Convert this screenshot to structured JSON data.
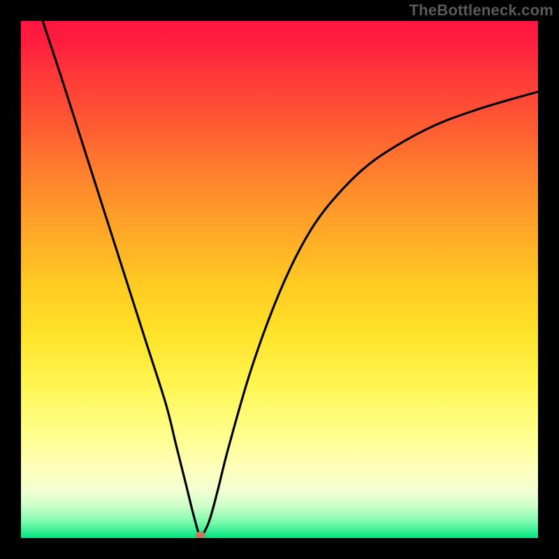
{
  "watermark": "TheBottleneck.com",
  "marker": {
    "x_frac": 0.347,
    "y_frac": 0.994,
    "color": "#c77964"
  },
  "chart_data": {
    "type": "line",
    "title": "",
    "xlabel": "",
    "ylabel": "",
    "xlim": [
      0,
      100
    ],
    "ylim": [
      0,
      100
    ],
    "grid": false,
    "series": [
      {
        "name": "bottleneck-curve",
        "x": [
          4.2,
          8,
          12,
          16,
          20,
          24,
          28,
          30,
          32,
          33.5,
          34.7,
          36.3,
          38,
          40,
          44,
          48,
          52,
          56,
          60,
          66,
          72,
          80,
          88,
          96,
          100
        ],
        "y": [
          100,
          88.5,
          76,
          63.5,
          51,
          38.5,
          26,
          18,
          10,
          4,
          0.6,
          3,
          9,
          17,
          31,
          42.5,
          52,
          59.5,
          65,
          71.2,
          75.5,
          79.8,
          82.8,
          85.2,
          86.3
        ]
      }
    ],
    "annotations": [
      {
        "type": "marker",
        "x": 34.7,
        "y": 0.6,
        "label": "optimal-point",
        "color": "#c77964"
      }
    ],
    "background": {
      "type": "vertical-gradient",
      "stops": [
        {
          "pos": 0.0,
          "color": "#ff1641"
        },
        {
          "pos": 0.5,
          "color": "#ffc823"
        },
        {
          "pos": 0.87,
          "color": "#fcffbe"
        },
        {
          "pos": 1.0,
          "color": "#00e682"
        }
      ]
    }
  }
}
